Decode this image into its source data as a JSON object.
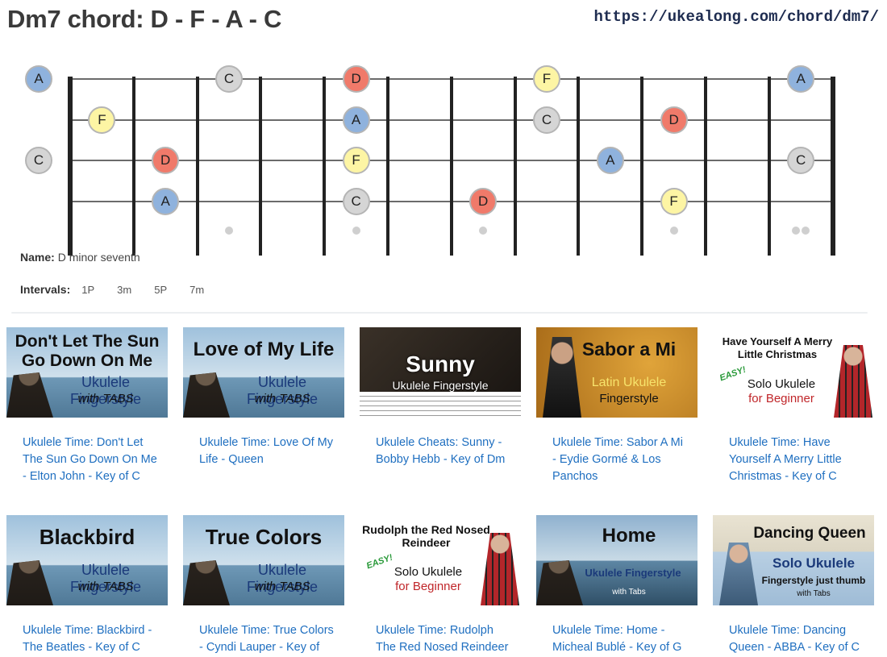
{
  "header": {
    "title": "Dm7 chord: D - F - A - C",
    "url": "https://ukealong.com/chord/dm7/"
  },
  "fretboard": {
    "strings": 4,
    "frets": 12,
    "inlay_frets": [
      3,
      5,
      7,
      10,
      12
    ],
    "note_colors": {
      "D": "#f07a6a",
      "F": "#fdf5a4",
      "A": "#8fb2dd",
      "C": "#d5d5d5"
    },
    "notes": [
      {
        "string": 1,
        "fret": 0,
        "label": "A"
      },
      {
        "string": 1,
        "fret": 3,
        "label": "C"
      },
      {
        "string": 1,
        "fret": 5,
        "label": "D"
      },
      {
        "string": 1,
        "fret": 8,
        "label": "F"
      },
      {
        "string": 1,
        "fret": 12,
        "label": "A"
      },
      {
        "string": 2,
        "fret": 1,
        "label": "F"
      },
      {
        "string": 2,
        "fret": 5,
        "label": "A"
      },
      {
        "string": 2,
        "fret": 8,
        "label": "C"
      },
      {
        "string": 2,
        "fret": 10,
        "label": "D"
      },
      {
        "string": 3,
        "fret": 0,
        "label": "C"
      },
      {
        "string": 3,
        "fret": 2,
        "label": "D"
      },
      {
        "string": 3,
        "fret": 5,
        "label": "F"
      },
      {
        "string": 3,
        "fret": 9,
        "label": "A"
      },
      {
        "string": 3,
        "fret": 12,
        "label": "C"
      },
      {
        "string": 4,
        "fret": 2,
        "label": "A"
      },
      {
        "string": 4,
        "fret": 5,
        "label": "C"
      },
      {
        "string": 4,
        "fret": 7,
        "label": "D"
      },
      {
        "string": 4,
        "fret": 10,
        "label": "F"
      }
    ]
  },
  "info": {
    "name_label": "Name:",
    "name_value": "D minor seventh",
    "intervals_label": "Intervals:",
    "intervals": [
      "1P",
      "3m",
      "5P",
      "7m"
    ]
  },
  "videos": [
    {
      "thumb_title": "Don't Let The Sun Go Down On Me",
      "thumb_sub": "Ukulele Fingerstyle",
      "thumb_note": "with TABS",
      "caption": "Ukulele Time: Don't Let The Sun Go Down On Me - Elton John - Key of C"
    },
    {
      "thumb_title": "Love of My Life",
      "thumb_sub": "Ukulele Fingerstyle",
      "thumb_note": "with TABS",
      "caption": "Ukulele Time: Love Of My Life - Queen"
    },
    {
      "thumb_title": "Sunny",
      "thumb_sub": "Ukulele Fingerstyle",
      "thumb_note": "",
      "caption": "Ukulele Cheats: Sunny - Bobby Hebb - Key of Dm"
    },
    {
      "thumb_title": "Sabor a Mi",
      "thumb_sub": "Latin Ukulele",
      "thumb_note": "Fingerstyle",
      "caption": "Ukulele Time: Sabor A Mi - Eydie Gormé & Los Panchos"
    },
    {
      "thumb_title": "Have Yourself A Merry Little Christmas",
      "thumb_sub": "Solo Ukulele",
      "thumb_note": "for Beginner",
      "thumb_badge": "EASY!",
      "caption": "Ukulele Time: Have Yourself A Merry Little Christmas - Key of C"
    },
    {
      "thumb_title": "Blackbird",
      "thumb_sub": "Ukulele Fingerstyle",
      "thumb_note": "with TABS",
      "caption": "Ukulele Time: Blackbird - The Beatles - Key of C"
    },
    {
      "thumb_title": "True Colors",
      "thumb_sub": "Ukulele Fingerstyle",
      "thumb_note": "with TABS",
      "caption": "Ukulele Time: True Colors - Cyndi Lauper - Key of"
    },
    {
      "thumb_title": "Rudolph the Red Nosed Reindeer",
      "thumb_sub": "Solo Ukulele",
      "thumb_note": "for Beginner",
      "thumb_badge": "EASY!",
      "caption": "Ukulele Time: Rudolph The Red Nosed Reindeer"
    },
    {
      "thumb_title": "Home",
      "thumb_sub": "Ukulele Fingerstyle",
      "thumb_note": "with Tabs",
      "caption": "Ukulele Time: Home - Micheal Bublé - Key of G"
    },
    {
      "thumb_title": "Dancing Queen",
      "thumb_sub": "Solo Ukulele",
      "thumb_note": "Fingerstyle just thumb",
      "thumb_note2": "with Tabs",
      "caption": "Ukulele Time: Dancing Queen - ABBA - Key of C"
    }
  ]
}
